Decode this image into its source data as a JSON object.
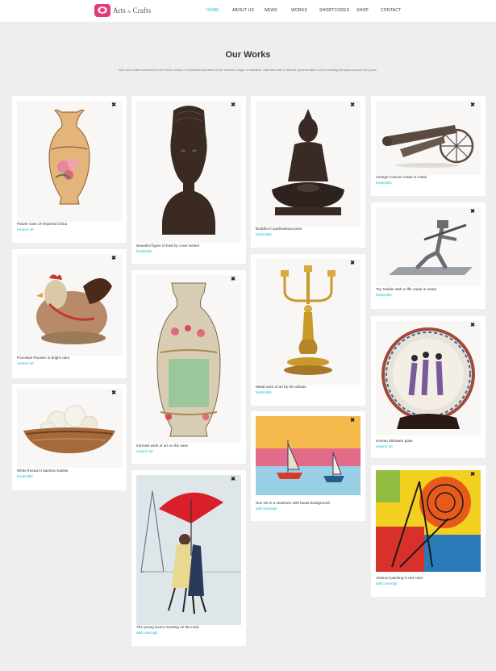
{
  "brand": {
    "name_left": "Arts",
    "name_amp": "&",
    "name_right": "Crafts"
  },
  "nav": [
    "HOME",
    "ABOUT US",
    "NEWS",
    "WORKS",
    "SHORTCODES",
    "SHOP",
    "CONTACT"
  ],
  "section": {
    "title": "Our Works",
    "intro": "Arts and crafts evolved from the fixed notions of fundamental ideas to the modern usage of available materials with a truthful representation of the existing lifestyles around the place."
  },
  "close_glyph": "✖",
  "works": [
    {
      "caption": "Flower vase of emperial China",
      "category": "ceramic art",
      "icon": "vase-image"
    },
    {
      "caption": "Porcelain Rooster in bright color",
      "category": "ceramic art",
      "icon": "rooster-image"
    },
    {
      "caption": "White thread in bamboo basket",
      "category": "handcrafts",
      "icon": "basket-image"
    },
    {
      "caption": "Beautiful figure of bust by court worker",
      "category": "handcrafts",
      "icon": "bust-image"
    },
    {
      "caption": "Intricate work of art on the vase",
      "category": "ceramic art",
      "icon": "tall-vase-image"
    },
    {
      "caption": "The young lovers meeting on the road",
      "category": "wall coverings",
      "icon": "painting-image"
    },
    {
      "caption": "Buddha in padmasana pose",
      "category": "handcrafts",
      "icon": "buddha-image"
    },
    {
      "caption": "Metal work of art by the artisan",
      "category": "handcrafts",
      "icon": "candlestick-image"
    },
    {
      "caption": "Sun set in a seashore with boats background",
      "category": "wall coverings",
      "icon": "boats-painting-image"
    },
    {
      "caption": "Vintage Cannon made in metal",
      "category": "handcrafts",
      "icon": "cannon-image"
    },
    {
      "caption": "Toy Soldier with a rifle made in metal",
      "category": "handcrafts",
      "icon": "soldier-image"
    },
    {
      "caption": "Korean dishware plate",
      "category": "ceramic art",
      "icon": "plate-image"
    },
    {
      "caption": "Abstract painting in red color",
      "category": "wall coverings",
      "icon": "abstract-painting-image"
    }
  ]
}
